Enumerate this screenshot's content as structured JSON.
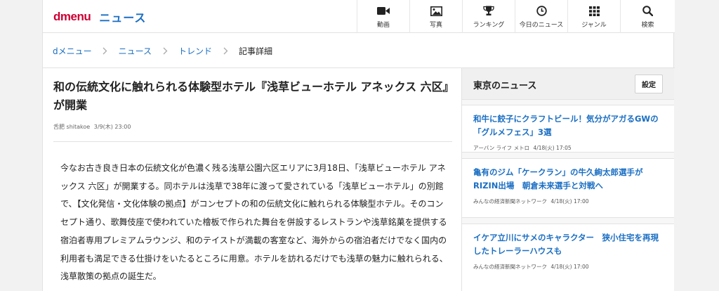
{
  "header": {
    "logo_text": "dmenu",
    "section_text": "ニュース",
    "nav": [
      {
        "label": "動画",
        "icon": "video-icon"
      },
      {
        "label": "写真",
        "icon": "photo-icon"
      },
      {
        "label": "ランキング",
        "icon": "trophy-icon"
      },
      {
        "label": "今日のニュース",
        "icon": "clock-icon"
      },
      {
        "label": "ジャンル",
        "icon": "grid-icon"
      },
      {
        "label": "検索",
        "icon": "search-icon"
      }
    ]
  },
  "breadcrumb": [
    "dメニュー",
    "ニュース",
    "トレンド",
    "記事詳細"
  ],
  "article": {
    "title": "和の伝統文化に触れられる体験型ホテル『浅草ビューホテル アネックス 六区』が開業",
    "author": "舌肥 shitakoe",
    "date": "3/9(木) 23:00",
    "body": "今なお古き良き日本の伝統文化が色濃く残る浅草公園六区エリアに3月18日、「浅草ビューホテル アネックス 六区」が開業する。同ホテルは浅草で38年に渡って愛されている「浅草ビューホテル」の別館で、【文化発信・文化体験の拠点】がコンセプトの和の伝統文化に触れられる体験型ホテル。そのコンセプト通り、歌舞伎座で使われていた檜板で作られた舞台を併設するレストランや浅草銘菓を提供する宿泊者専用プレミアムラウンジ、和のテイストが満載の客室など、海外からの宿泊者だけでなく国内の利用者も満足できる仕掛けをいたるところに用意。ホテルを訪れるだけでも浅草の魅力に触れられる、浅草散策の拠点の誕生だ。"
  },
  "sidebar": {
    "title": "東京のニュース",
    "settings_label": "設定",
    "items": [
      {
        "title": "和牛に餃子にクラフトビール！気分がアガるGWの「グルメフェス」3選",
        "source": "アーバン ライフ メトロ",
        "date": "4/18(火) 17:05"
      },
      {
        "title": "亀有のジム「ケークラン」の牛久絢太郎選手がRIZIN出場　朝倉未来選手と対戦へ",
        "source": "みんなの経済新聞ネットワーク",
        "date": "4/18(火) 17:00"
      },
      {
        "title": "イケア立川にサメのキャラクター　狭小住宅を再現したトレーラーハウスも",
        "source": "みんなの経済新聞ネットワーク",
        "date": "4/18(火) 17:00"
      }
    ]
  },
  "colors": {
    "brand_red": "#cc0033",
    "link_blue": "#1a6ec3"
  }
}
